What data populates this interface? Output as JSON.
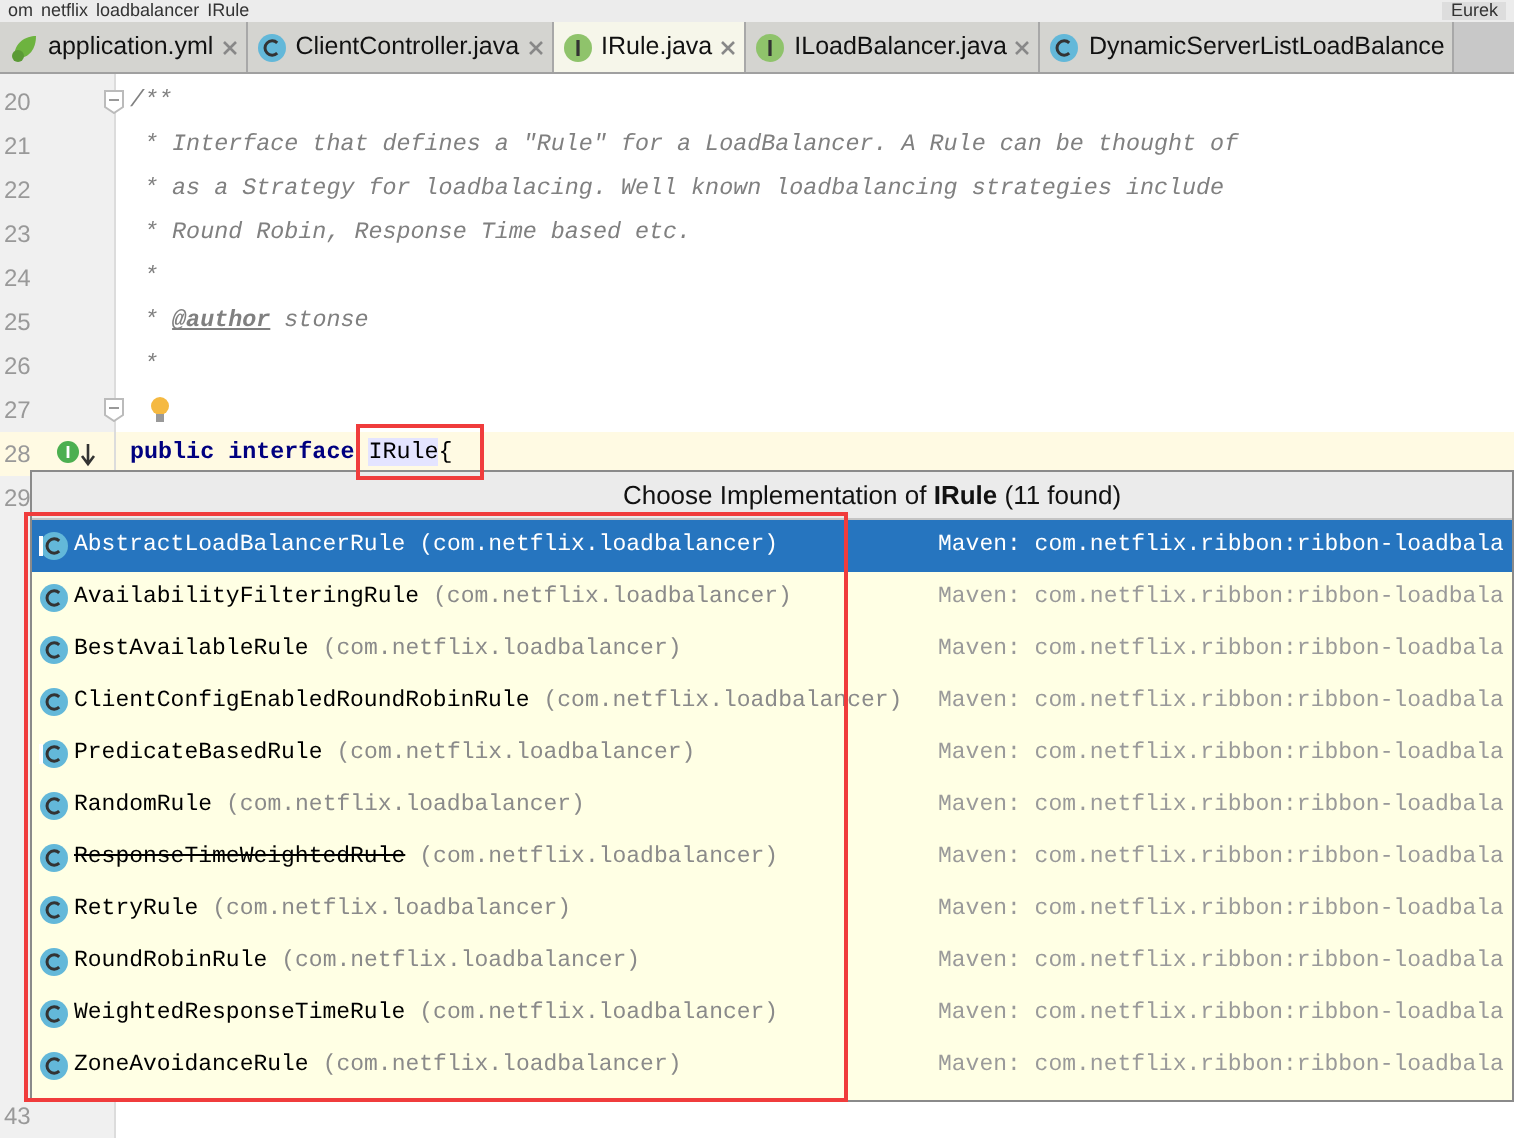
{
  "breadcrumb": [
    "om",
    "netflix",
    "loadbalancer",
    "IRule"
  ],
  "toolbar_right": {
    "label": "Eurek"
  },
  "tabs": [
    {
      "label": "application.yml",
      "kind": "spring",
      "selected": false
    },
    {
      "label": "ClientController.java",
      "kind": "class",
      "selected": false
    },
    {
      "label": "IRule.java",
      "kind": "interface",
      "selected": true
    },
    {
      "label": "ILoadBalancer.java",
      "kind": "interface",
      "selected": false
    },
    {
      "label": "DynamicServerListLoadBalance",
      "kind": "class",
      "selected": false
    }
  ],
  "lines": [
    {
      "number": "20",
      "fold": true,
      "segments": [
        {
          "kind": "comment",
          "text": "/**"
        }
      ]
    },
    {
      "number": "21",
      "segments": [
        {
          "kind": "comment",
          "text": " * Interface that defines a \"Rule\" for a LoadBalancer. A Rule can be thought of"
        }
      ]
    },
    {
      "number": "22",
      "segments": [
        {
          "kind": "comment",
          "text": " * as a Strategy for loadbalacing. Well known loadbalancing strategies include"
        }
      ]
    },
    {
      "number": "23",
      "segments": [
        {
          "kind": "comment",
          "text": " * Round Robin, Response Time based etc."
        }
      ]
    },
    {
      "number": "24",
      "segments": [
        {
          "kind": "comment",
          "text": " *"
        }
      ]
    },
    {
      "number": "25",
      "segments": [
        {
          "kind": "comment",
          "text": " * "
        },
        {
          "kind": "tag",
          "text": "@author"
        },
        {
          "kind": "comment",
          "text": " stonse"
        }
      ]
    },
    {
      "number": "26",
      "segments": [
        {
          "kind": "comment",
          "text": " *"
        }
      ]
    },
    {
      "number": "27",
      "fold": true,
      "bulb": true
    },
    {
      "number": "28",
      "current": true,
      "implemented": true,
      "segments": [
        {
          "kind": "keyword",
          "text": "public interface"
        },
        {
          "kind": "highlight",
          "text": "IRule",
          "space_before": true
        },
        {
          "kind": "plain",
          "text": "{"
        }
      ]
    },
    {
      "number": "29"
    }
  ],
  "last_line": "43",
  "popup": {
    "title": "Choose Implementation of **IRule** (11 found)",
    "items": [
      {
        "name": "AbstractLoadBalancerRule",
        "package": "(com.netflix.loadbalancer)",
        "library": "Maven: com.netflix.ribbon:ribbon-loadbala",
        "abstract": true,
        "deprecated": false,
        "selected": true
      },
      {
        "name": "AvailabilityFilteringRule",
        "package": "(com.netflix.loadbalancer)",
        "library": "Maven: com.netflix.ribbon:ribbon-loadbala",
        "abstract": false,
        "deprecated": false,
        "selected": false
      },
      {
        "name": "BestAvailableRule",
        "package": "(com.netflix.loadbalancer)",
        "library": "Maven: com.netflix.ribbon:ribbon-loadbala",
        "abstract": false,
        "deprecated": false,
        "selected": false
      },
      {
        "name": "ClientConfigEnabledRoundRobinRule",
        "package": "(com.netflix.loadbalancer)",
        "library": "Maven: com.netflix.ribbon:ribbon-loadbala",
        "abstract": false,
        "deprecated": false,
        "selected": false
      },
      {
        "name": "PredicateBasedRule",
        "package": "(com.netflix.loadbalancer)",
        "library": "Maven: com.netflix.ribbon:ribbon-loadbala",
        "abstract": true,
        "deprecated": false,
        "selected": false
      },
      {
        "name": "RandomRule",
        "package": "(com.netflix.loadbalancer)",
        "library": "Maven: com.netflix.ribbon:ribbon-loadbala",
        "abstract": false,
        "deprecated": false,
        "selected": false
      },
      {
        "name": "ResponseTimeWeightedRule",
        "package": "(com.netflix.loadbalancer)",
        "library": "Maven: com.netflix.ribbon:ribbon-loadbala",
        "abstract": false,
        "deprecated": true,
        "selected": false
      },
      {
        "name": "RetryRule",
        "package": "(com.netflix.loadbalancer)",
        "library": "Maven: com.netflix.ribbon:ribbon-loadbala",
        "abstract": false,
        "deprecated": false,
        "selected": false
      },
      {
        "name": "RoundRobinRule",
        "package": "(com.netflix.loadbalancer)",
        "library": "Maven: com.netflix.ribbon:ribbon-loadbala",
        "abstract": false,
        "deprecated": false,
        "selected": false
      },
      {
        "name": "WeightedResponseTimeRule",
        "package": "(com.netflix.loadbalancer)",
        "library": "Maven: com.netflix.ribbon:ribbon-loadbala",
        "abstract": false,
        "deprecated": false,
        "selected": false
      },
      {
        "name": "ZoneAvoidanceRule",
        "package": "(com.netflix.loadbalancer)",
        "library": "Maven: com.netflix.ribbon:ribbon-loadbala",
        "abstract": false,
        "deprecated": false,
        "selected": false
      }
    ]
  }
}
